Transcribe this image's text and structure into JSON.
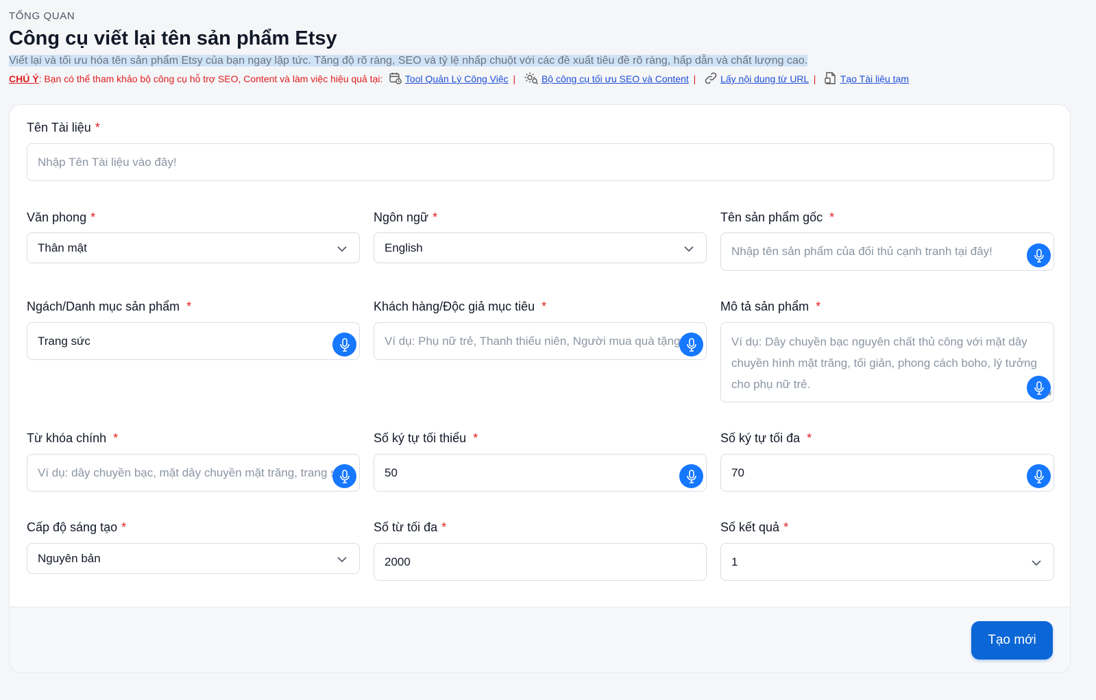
{
  "header": {
    "overline": "TỔNG QUAN",
    "title": "Công cụ viết lại tên sản phẩm Etsy",
    "subtitle": "Viết lại và tối ưu hóa tên sản phẩm Etsy của bạn ngay lập tức. Tăng độ rõ ràng, SEO và tỷ lệ nhấp chuột với các đề xuất tiêu đề rõ ràng, hấp dẫn và chất lượng cao.",
    "note_prefix": "CHÚ Ý",
    "note_text": ": Bạn có thể tham khảo bộ công cụ hỗ trợ SEO, Content và làm việc hiệu quả tại:",
    "links": [
      {
        "label": "Tool Quản Lý Công Việc",
        "icon": "calendar-clock-icon"
      },
      {
        "label": "Bộ công cụ tối ưu SEO và Content",
        "icon": "gear-search-icon"
      },
      {
        "label": "Lấy nội dung từ URL",
        "icon": "link-icon"
      },
      {
        "label": "Tạo Tài liệu tạm",
        "icon": "document-icon"
      }
    ],
    "separator": "|"
  },
  "form": {
    "doc_name": {
      "label": "Tên Tài liệu",
      "placeholder": "Nhập Tên Tài liệu vào đây!",
      "value": ""
    },
    "tone": {
      "label": "Văn phong",
      "value": "Thân mật"
    },
    "language": {
      "label": "Ngôn ngữ",
      "value": "English"
    },
    "original_name": {
      "label": "Tên sản phẩm gốc",
      "placeholder": "Nhập tên sản phẩm của đối thủ cạnh tranh tại đây!",
      "value": ""
    },
    "niche": {
      "label": "Ngách/Danh mục sản phẩm",
      "value": "Trang sức"
    },
    "audience": {
      "label": "Khách hàng/Độc giả mục tiêu",
      "placeholder": "Ví dụ: Phụ nữ trẻ, Thanh thiếu niên, Người mua quà tặng",
      "value": ""
    },
    "description": {
      "label": "Mô tả sản phẩm",
      "placeholder": "Ví dụ: Dây chuyền bạc nguyên chất thủ công với mặt dây chuyền hình mặt trăng, tối giản, phong cách boho, lý tưởng cho phụ nữ trẻ."
    },
    "keywords": {
      "label": "Từ khóa chính",
      "placeholder": "Ví dụ: dây chuyền bạc, mặt dây chuyền mặt trăng, trang sức boho",
      "value": ""
    },
    "min_chars": {
      "label": "Số ký tự tối thiểu",
      "value": "50"
    },
    "max_chars": {
      "label": "Số ký tự tối đa",
      "value": "70"
    },
    "creativity": {
      "label": "Cấp độ sáng tạo",
      "value": "Nguyên bản"
    },
    "max_words": {
      "label": "Số từ tối đa",
      "value": "2000"
    },
    "results": {
      "label": "Số kết quả",
      "value": "1"
    },
    "required_mark": "*"
  },
  "footer": {
    "create_label": "Tạo mới"
  },
  "colors": {
    "accent": "#0b66d6",
    "mic": "#1677ff",
    "required": "#e11d1d",
    "link": "#1d4ed8"
  }
}
